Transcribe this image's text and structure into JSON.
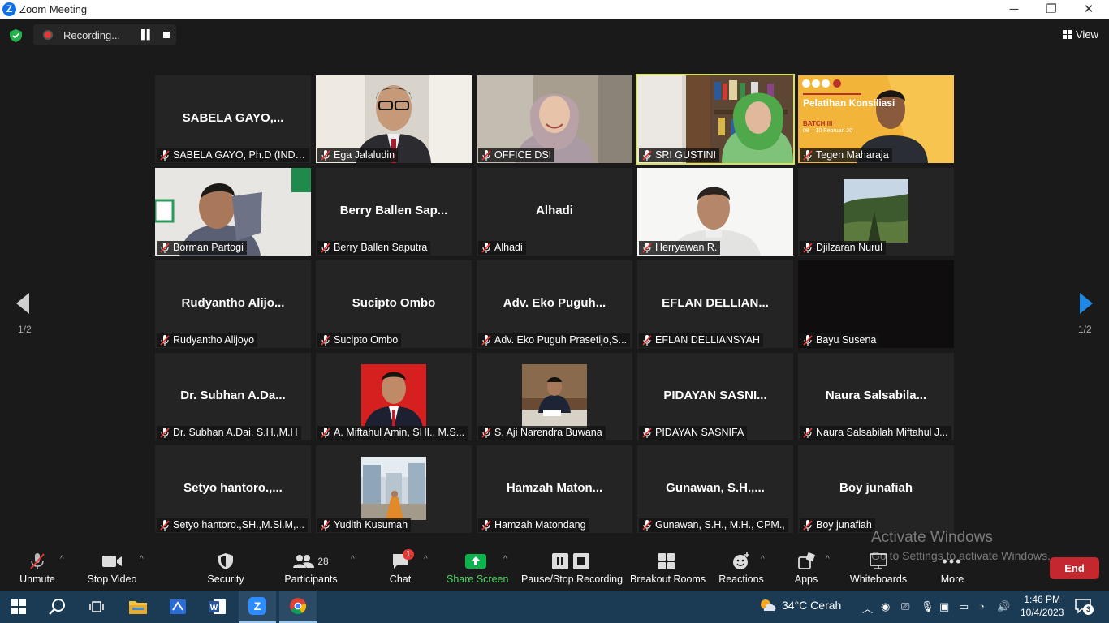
{
  "window": {
    "title": "Zoom Meeting",
    "minimize": "─",
    "restore": "❐",
    "close": "✕"
  },
  "top": {
    "recording_label": "Recording...",
    "view_label": "View"
  },
  "pager": {
    "left_label": "1/2",
    "right_label": "1/2"
  },
  "participants": [
    {
      "display": "SABELA GAYO,...",
      "label": "SABELA GAYO, Ph.D (INDO..."
    },
    {
      "display": "",
      "label": "Ega Jalaludin",
      "video": "man-glasses"
    },
    {
      "display": "",
      "label": "OFFICE DSI",
      "video": "woman-hijab"
    },
    {
      "display": "",
      "label": "SRI GUSTINI",
      "video": "woman-bookshelf",
      "active": true
    },
    {
      "display": "",
      "label": "Tegen Maharaja",
      "video": "banner",
      "banner_title": "Pelatihan Konsiliasi",
      "banner_batch": "BATCH III",
      "banner_date": "08 – 10 Februari 20"
    },
    {
      "display": "",
      "label": "Borman Partogi",
      "video": "man-room"
    },
    {
      "display": "Berry Ballen Sap...",
      "label": "Berry Ballen Saputra"
    },
    {
      "display": "Alhadi",
      "label": "Alhadi"
    },
    {
      "display": "",
      "label": "Herryawan R.",
      "video": "man-white"
    },
    {
      "display": "",
      "label": "Djilzaran Nurul",
      "picture": "forest"
    },
    {
      "display": "Rudyantho  Alijo...",
      "label": "Rudyantho Alijoyo"
    },
    {
      "display": "Sucipto Ombo",
      "label": "Sucipto Ombo"
    },
    {
      "display": "Adv.  Eko  Puguh...",
      "label": "Adv. Eko Puguh Prasetijo,S..."
    },
    {
      "display": "EFLAN DELLIAN...",
      "label": "EFLAN DELLIANSYAH"
    },
    {
      "display": "",
      "label": "Bayu Susena",
      "video": "dark"
    },
    {
      "display": "Dr.  Subhan  A.Da...",
      "label": "Dr. Subhan A.Dai, S.H.,M.H"
    },
    {
      "display": "",
      "label": "A. Miftahul Amin, SHI., M.S...",
      "picture": "portrait-red"
    },
    {
      "display": "",
      "label": "S. Aji Narendra Buwana",
      "picture": "desk"
    },
    {
      "display": "PIDAYAN SASNI...",
      "label": "PIDAYAN SASNIFA"
    },
    {
      "display": "Naura  Salsabila...",
      "label": "Naura Salsabilah Miftahul J..."
    },
    {
      "display": "Setyo  hantoro.,...",
      "label": "Setyo hantoro.,SH.,M.Si.M,..."
    },
    {
      "display": "",
      "label": "Yudith Kusumah",
      "picture": "street"
    },
    {
      "display": "Hamzah  Maton...",
      "label": "Hamzah Matondang"
    },
    {
      "display": "Gunawan,  S.H.,...",
      "label": "Gunawan, S.H., M.H., CPM.,"
    },
    {
      "display": "Boy junafiah",
      "label": "Boy junafiah"
    }
  ],
  "toolbar": {
    "unmute": "Unmute",
    "stop_video": "Stop Video",
    "security": "Security",
    "participants": "Participants",
    "participants_count": "28",
    "chat": "Chat",
    "chat_badge": "1",
    "share_screen": "Share Screen",
    "pause_stop": "Pause/Stop Recording",
    "breakout": "Breakout Rooms",
    "reactions": "Reactions",
    "apps": "Apps",
    "whiteboards": "Whiteboards",
    "more": "More",
    "end": "End"
  },
  "watermark": {
    "line1": "Activate Windows",
    "line2": "Go to Settings to activate Windows."
  },
  "taskbar": {
    "weather": "34°C  Cerah",
    "time": "1:46 PM",
    "date": "10/4/2023",
    "notif_count": "3"
  },
  "colors": {
    "accent_blue": "#0e71eb",
    "share_green": "#0bb34f",
    "end_red": "#c4272d",
    "speaker_highlight": "#d7e25a",
    "taskbar": "#1b3b55"
  }
}
